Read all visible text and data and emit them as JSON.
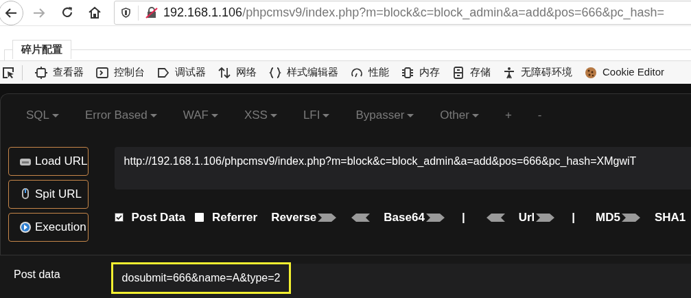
{
  "address_bar": {
    "host": "192.168.1.106",
    "path": "/phpcmsv9/index.php?m=block&c=block_admin&a=add&pos=666&pc_hash="
  },
  "page_tab": {
    "label": "碎片配置"
  },
  "devtools_tabs": [
    {
      "label": "查看器"
    },
    {
      "label": "控制台"
    },
    {
      "label": "调试器"
    },
    {
      "label": "网络"
    },
    {
      "label": "样式编辑器"
    },
    {
      "label": "性能"
    },
    {
      "label": "内存"
    },
    {
      "label": "存储"
    },
    {
      "label": "无障碍环境"
    },
    {
      "label": "Cookie Editor"
    }
  ],
  "menu": [
    {
      "label": "SQL",
      "caret": true
    },
    {
      "label": "Error Based",
      "caret": true
    },
    {
      "label": "WAF",
      "caret": true
    },
    {
      "label": "XSS",
      "caret": true
    },
    {
      "label": "LFI",
      "caret": true
    },
    {
      "label": "Bypasser",
      "caret": true
    },
    {
      "label": "Other",
      "caret": true
    },
    {
      "label": "+",
      "caret": false
    },
    {
      "label": "-",
      "caret": false
    }
  ],
  "actions": [
    {
      "label": "Load URL"
    },
    {
      "label": "Spit URL"
    },
    {
      "label": "Execution"
    }
  ],
  "url_value": "http://192.168.1.106/phpcmsv9/index.php?m=block&c=block_admin&a=add&pos=666&pc_hash=XMgwiT",
  "options": [
    {
      "kind": "checkbox",
      "label": "Post Data",
      "checked": true
    },
    {
      "kind": "checkbox",
      "label": "Referrer",
      "checked": false
    },
    {
      "kind": "encoder",
      "label": "Reverse",
      "left_arrow": false,
      "right_arrow": true
    },
    {
      "kind": "encoder",
      "label": "Base64",
      "left_arrow": true,
      "right_arrow": true
    },
    {
      "kind": "separator",
      "label": "|"
    },
    {
      "kind": "encoder",
      "label": "Url",
      "left_arrow": true,
      "right_arrow": true
    },
    {
      "kind": "separator",
      "label": "|"
    },
    {
      "kind": "encoder",
      "label": "MD5",
      "left_arrow": false,
      "right_arrow": true
    },
    {
      "kind": "encoder",
      "label": "SHA1",
      "left_arrow": false,
      "right_arrow": false
    }
  ],
  "post_data": {
    "label": "Post data",
    "value": "dosubmit=666&name=A&type=2",
    "highlighted": true
  }
}
